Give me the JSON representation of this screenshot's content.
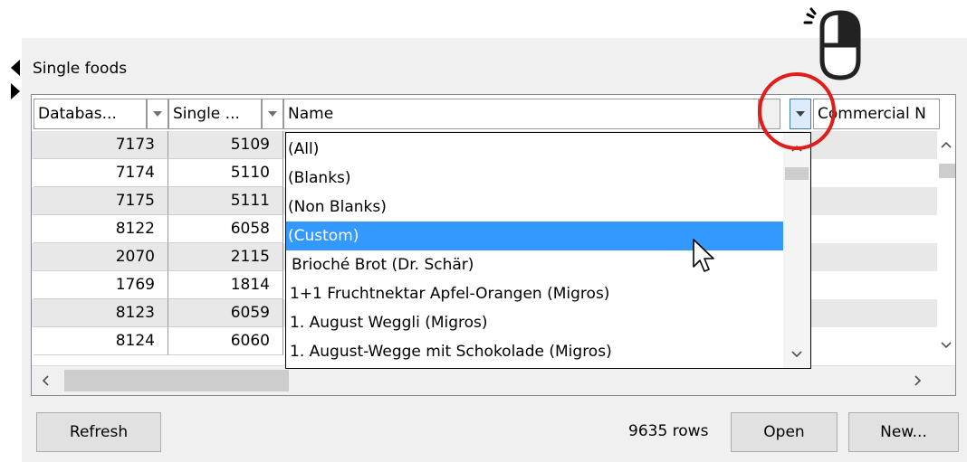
{
  "panel": {
    "title": "Single foods"
  },
  "columns": [
    {
      "label": "Databas..."
    },
    {
      "label": "Single ..."
    },
    {
      "label": "Name"
    },
    {
      "label": "Commercial N"
    }
  ],
  "rows": [
    {
      "database_id": "7173",
      "single_id": "5109"
    },
    {
      "database_id": "7174",
      "single_id": "5110"
    },
    {
      "database_id": "7175",
      "single_id": "5111"
    },
    {
      "database_id": "8122",
      "single_id": "6058"
    },
    {
      "database_id": "2070",
      "single_id": "2115"
    },
    {
      "database_id": "1769",
      "single_id": "1814"
    },
    {
      "database_id": "8123",
      "single_id": "6059"
    },
    {
      "database_id": "8124",
      "single_id": "6060"
    }
  ],
  "filter_dropdown": {
    "items": [
      "(All)",
      "(Blanks)",
      "(Non Blanks)",
      "(Custom)",
      " Brioché Brot (Dr. Schär)",
      "1+1 Fruchtnektar Apfel-Orangen (Migros)",
      "1. August Weggli (Migros)",
      "1. August-Wegge mit Schokolade (Migros)"
    ],
    "selected_index": 3
  },
  "footer": {
    "refresh_label": "Refresh",
    "row_count": "9635 rows",
    "open_label": "Open",
    "new_label": "New..."
  },
  "colors": {
    "highlight": "#3399ff",
    "annotation_circle": "#e21b1b",
    "row_alt": "#e8e8e8"
  },
  "icons": {
    "mouse": "mouse-left-click-icon",
    "cursor": "arrow-cursor-icon"
  }
}
